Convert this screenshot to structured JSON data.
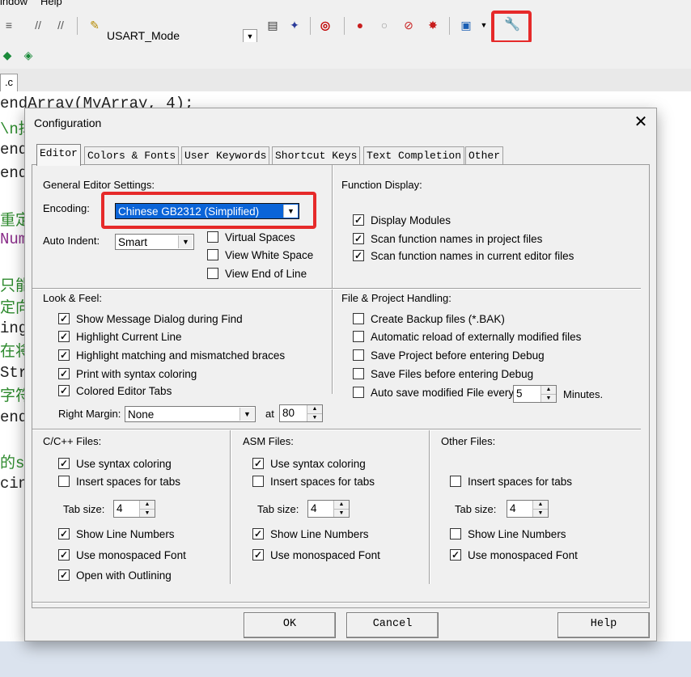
{
  "app": {
    "menu": [
      "indow",
      "Help"
    ],
    "target_name": "USART_Mode",
    "file_tab_label": ".c",
    "code_lines": [
      {
        "text": "endArray(MyArray, 4);",
        "color": "dark"
      },
      {
        "text": "\\n掉",
        "color": "green"
      },
      {
        "text": "end",
        "color": "dark"
      },
      {
        "text": "end",
        "color": "dark"
      },
      {
        "text": "重定",
        "color": "green"
      },
      {
        "text": "Num",
        "color": "purple"
      },
      {
        "text": "只能",
        "color": "green"
      },
      {
        "text": "定向",
        "color": "green"
      },
      {
        "text": "ing",
        "color": "dark"
      },
      {
        "text": "在将",
        "color": "green"
      },
      {
        "text": "Str",
        "color": "dark"
      },
      {
        "text": "字符",
        "color": "green"
      },
      {
        "text": "end",
        "color": "dark"
      },
      {
        "text": "的s",
        "color": "green"
      },
      {
        "text": "cin",
        "color": "dark"
      }
    ],
    "highlight_color": "#e62a2a"
  },
  "dialog": {
    "title": "Configuration",
    "close_glyph": "✕",
    "tabs": [
      "Editor",
      "Colors & Fonts",
      "User Keywords",
      "Shortcut Keys",
      "Text Completion",
      "Other"
    ],
    "active_tab": "Editor",
    "general": {
      "label": "General Editor Settings:",
      "encoding_label": "Encoding:",
      "encoding_value": "Chinese GB2312 (Simplified)",
      "auto_indent_label": "Auto Indent:",
      "auto_indent_value": "Smart",
      "virtual_spaces": "Virtual Spaces",
      "view_white_space": "View White Space",
      "view_end_of_line": "View End of Line"
    },
    "function_display": {
      "label": "Function Display:",
      "display_modules": "Display Modules",
      "scan_project": "Scan function names in project files",
      "scan_editor": "Scan function names in current editor files"
    },
    "look_feel": {
      "label": "Look & Feel:",
      "show_message": "Show Message Dialog during Find",
      "highlight_line": "Highlight Current Line",
      "highlight_braces": "Highlight matching and mismatched braces",
      "print_syntax": "Print with syntax coloring",
      "colored_tabs": "Colored Editor Tabs",
      "right_margin_label": "Right Margin:",
      "right_margin_value": "None",
      "at_label": "at",
      "at_value": "80"
    },
    "file_project": {
      "label": "File & Project Handling:",
      "create_backup": "Create Backup files (*.BAK)",
      "auto_reload": "Automatic reload of externally modified files",
      "save_project": "Save Project before entering Debug",
      "save_files": "Save Files before entering Debug",
      "auto_save": "Auto save modified File every",
      "auto_save_value": "5",
      "minutes": "Minutes."
    },
    "cpp_files": {
      "label": "C/C++ Files:",
      "syntax": "Use syntax coloring",
      "insert_spaces": "Insert spaces for tabs",
      "tab_size_label": "Tab size:",
      "tab_size": "4",
      "line_numbers": "Show Line Numbers",
      "monospaced": "Use monospaced Font",
      "outlining": "Open with Outlining"
    },
    "asm_files": {
      "label": "ASM Files:",
      "syntax": "Use syntax coloring",
      "insert_spaces": "Insert spaces for tabs",
      "tab_size_label": "Tab size:",
      "tab_size": "4",
      "line_numbers": "Show Line Numbers",
      "monospaced": "Use monospaced Font"
    },
    "other_files": {
      "label": "Other Files:",
      "insert_spaces": "Insert spaces for tabs",
      "tab_size_label": "Tab size:",
      "tab_size": "4",
      "line_numbers": "Show Line Numbers",
      "monospaced": "Use monospaced Font"
    },
    "buttons": {
      "ok": "OK",
      "cancel": "Cancel",
      "help": "Help"
    },
    "check_glyph": "✓"
  }
}
